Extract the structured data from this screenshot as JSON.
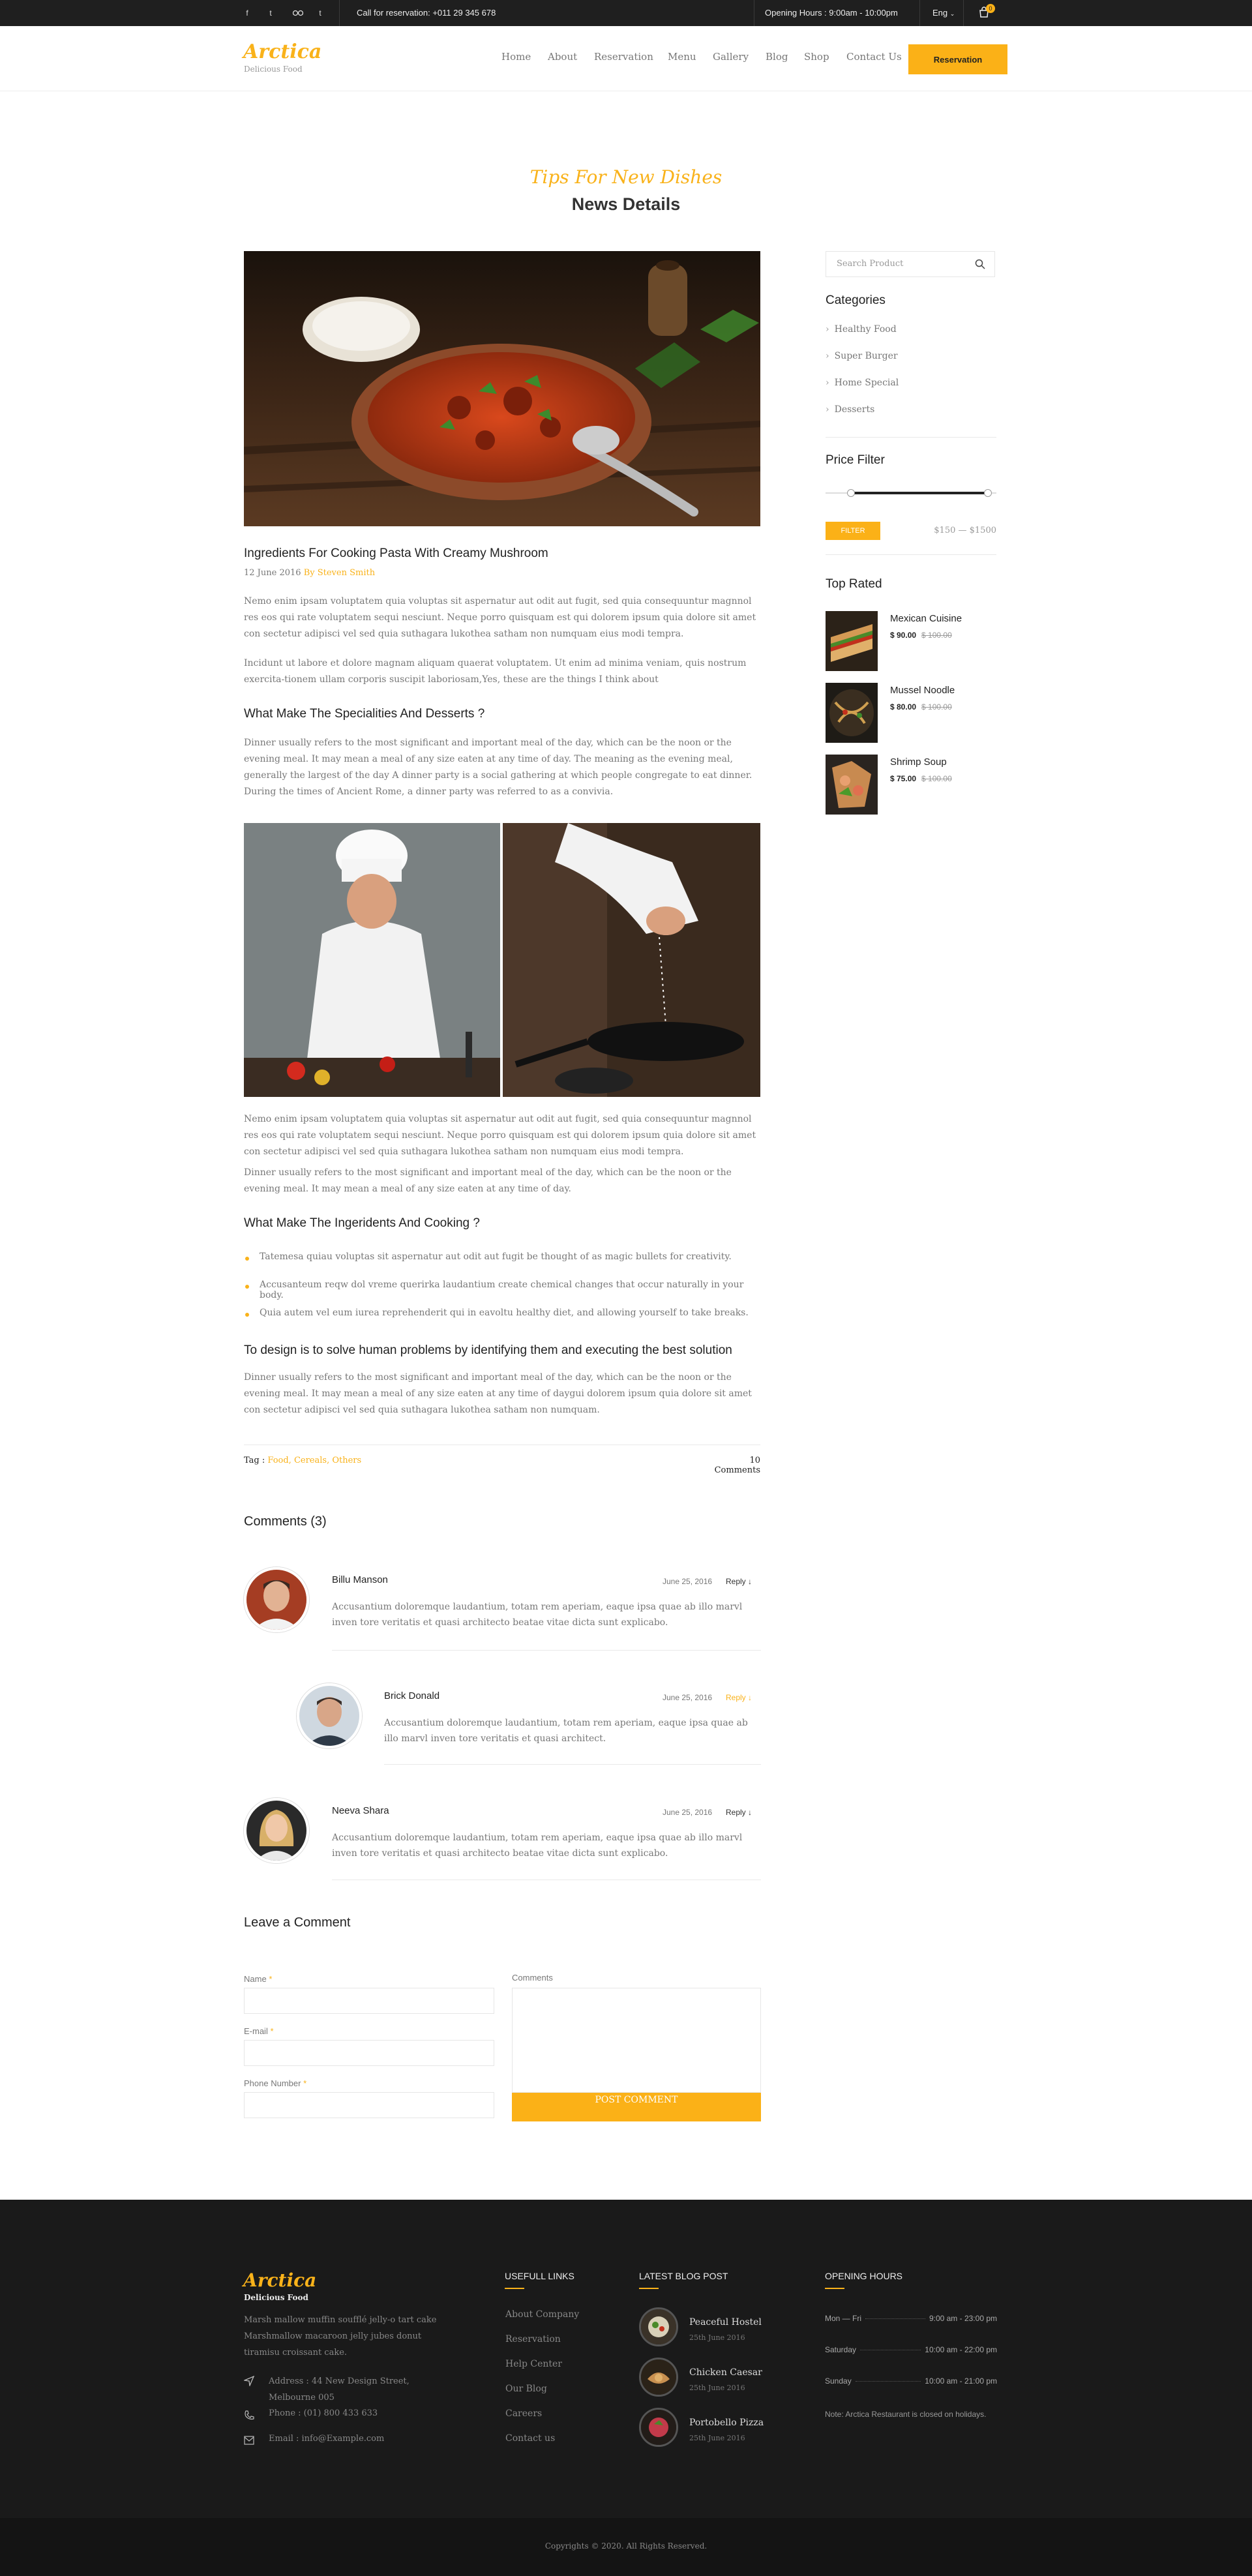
{
  "topbar": {
    "social": [
      "f",
      "t",
      "in",
      "t"
    ],
    "reservation_call": "Call for reservation: +011 29 345 678",
    "opening_hours": "Opening Hours : 9:00am - 10:00pm",
    "language": "Eng",
    "cart_count": "0"
  },
  "brand": {
    "name": "Arctica",
    "tagline": "Delicious Food"
  },
  "nav": {
    "links": [
      "Home",
      "About",
      "Reservation",
      "Menu",
      "Gallery",
      "Blog",
      "Shop",
      "Contact Us"
    ],
    "cta": "Reservation"
  },
  "hero": {
    "subtitle": "Tips For New Dishes",
    "title": "News Details"
  },
  "article": {
    "title": "Ingredients For Cooking Pasta With Creamy Mushroom",
    "date": "12 June 2016",
    "author": "By Steven Smith",
    "p1": "Nemo enim ipsam voluptatem quia voluptas sit aspernatur aut odit aut fugit, sed quia consequuntur magnnol res eos qui rate voluptatem sequi nesciunt. Neque porro quisquam est qui dolorem ipsum quia dolore sit amet con sectetur adipisci vel sed quia suthagara lukothea satham non numquam eius modi tempra.",
    "p2": "Incidunt ut labore et dolore magnam aliquam quaerat voluptatem. Ut enim ad minima veniam, quis nostrum exercita-tionem ullam corporis suscipit laboriosam,Yes, these are the things I think about",
    "h_specialities": "What Make The Specialities And Desserts ?",
    "p3": "Dinner usually refers to the most significant and important meal of the day, which can be the noon or the evening meal. It may mean a meal of any size eaten at any time of day. The meaning as the evening meal, generally the largest of the day A dinner party is a social gathering at which people congregate to eat dinner. During the times of Ancient Rome, a dinner party was referred to as a convivia.",
    "p4": "Nemo enim ipsam voluptatem quia voluptas sit aspernatur aut odit aut fugit, sed quia consequuntur magnnol res eos qui rate voluptatem sequi nesciunt. Neque porro quisquam est qui dolorem ipsum quia dolore sit amet con sectetur adipisci vel sed quia suthagara lukothea satham non numquam eius modi tempra.",
    "p5": "Dinner usually refers to the most significant and important meal of the day, which can be the noon or the evening meal. It may mean a meal of any size eaten at any time of day.",
    "h_ingredients": "What Make The Ingeridents And Cooking ?",
    "bullets": [
      "Tatemesa quiau voluptas sit aspernatur aut odit aut fugit be thought of as magic bullets for creativity.",
      "Accusanteum reqw dol vreme querirka laudantium create chemical changes that occur naturally in your body.",
      "Quia autem vel eum iurea reprehenderit qui in eavoltu healthy diet, and allowing yourself to take breaks."
    ],
    "h_design": "To design is to solve human problems by identifying them and executing the best solution",
    "p6": "Dinner usually refers to the most significant and important meal of the day, which can be the noon or the evening meal. It may mean a meal of any size eaten at any time of daygui dolorem ipsum quia dolore sit amet con sectetur adipisci vel sed quia suthagara lukothea satham non numquam.",
    "tag_label": "Tag :",
    "tags": "Food, Cereals, Others",
    "comments_count": "10 Comments"
  },
  "sidebar": {
    "search_placeholder": "Search Product",
    "categories_title": "Categories",
    "categories": [
      "Healthy Food",
      "Super Burger",
      "Home Special",
      "Desserts"
    ],
    "price_filter_title": "Price Filter",
    "filter_button": "FILTER",
    "price_range": "$150 — $1500",
    "price_range_fraction": [
      0.15,
      0.95
    ],
    "top_rated_title": "Top Rated",
    "top_rated": [
      {
        "name": "Mexican Cuisine",
        "price": "$ 90.00",
        "old": "$ 100.00"
      },
      {
        "name": "Mussel Noodle",
        "price": "$ 80.00",
        "old": "$ 100.00"
      },
      {
        "name": "Shrimp Soup",
        "price": "$ 75.00",
        "old": "$ 100.00"
      }
    ]
  },
  "comments": {
    "title": "Comments (3)",
    "items": [
      {
        "name": "Billu Manson",
        "date": "June 25, 2016",
        "reply": "Reply",
        "text": "Accusantium doloremque laudantium, totam rem aperiam, eaque ipsa quae ab illo marvl inven tore veritatis et quasi architecto beatae vitae dicta sunt explicabo."
      },
      {
        "name": "Brick Donald",
        "date": "June 25, 2016",
        "reply": "Reply",
        "text": "Accusantium doloremque laudantium, totam rem aperiam, eaque ipsa quae ab illo marvl inven tore veritatis et quasi architect."
      },
      {
        "name": "Neeva Shara",
        "date": "June 25, 2016",
        "reply": "Reply",
        "text": "Accusantium doloremque laudantium, totam rem aperiam, eaque ipsa quae ab illo marvl inven tore veritatis et quasi architecto beatae vitae dicta sunt explicabo."
      }
    ]
  },
  "form": {
    "title": "Leave a Comment",
    "name_label": "Name",
    "email_label": "E-mail",
    "phone_label": "Phone Number",
    "required_mark": "*",
    "comments_label": "Comments",
    "submit": "POST COMMENT"
  },
  "footer": {
    "brand": "Arctica",
    "tagline": "Delicious Food",
    "about": "Marsh mallow muffin soufflé jelly-o tart cake Marshmallow macaroon jelly jubes donut tiramisu croissant cake.",
    "address": "Address : 44 New Design Street, Melbourne 005",
    "phone": "Phone : (01) 800 433 633",
    "email": "Email : info@Example.com",
    "links_title": "USEFULL LINKS",
    "links": [
      "About Company",
      "Reservation",
      "Help Center",
      "Our Blog",
      "Careers",
      "Contact us"
    ],
    "blog_title": "LATEST BLOG POST",
    "blog_posts": [
      {
        "title": "Peaceful Hostel",
        "date": "25th June 2016"
      },
      {
        "title": "Chicken Caesar",
        "date": "25th June 2016"
      },
      {
        "title": "Portobello Pizza",
        "date": "25th June 2016"
      }
    ],
    "hours_title": "OPENING HOURS",
    "hours": [
      {
        "day": "Mon — Fri",
        "time": "9:00 am - 23:00 pm"
      },
      {
        "day": "Saturday",
        "time": "10:00 am - 22:00 pm"
      },
      {
        "day": "Sunday",
        "time": "10:00 am - 21:00 pm"
      }
    ],
    "note": "Note: Arctica Restaurant is closed on holidays.",
    "copyright": "Copyrights © 2020. All Rights Reserved."
  },
  "colors": {
    "accent": "#fbb117",
    "dark": "#1a1a1a",
    "topbar": "#1f1f1f"
  }
}
